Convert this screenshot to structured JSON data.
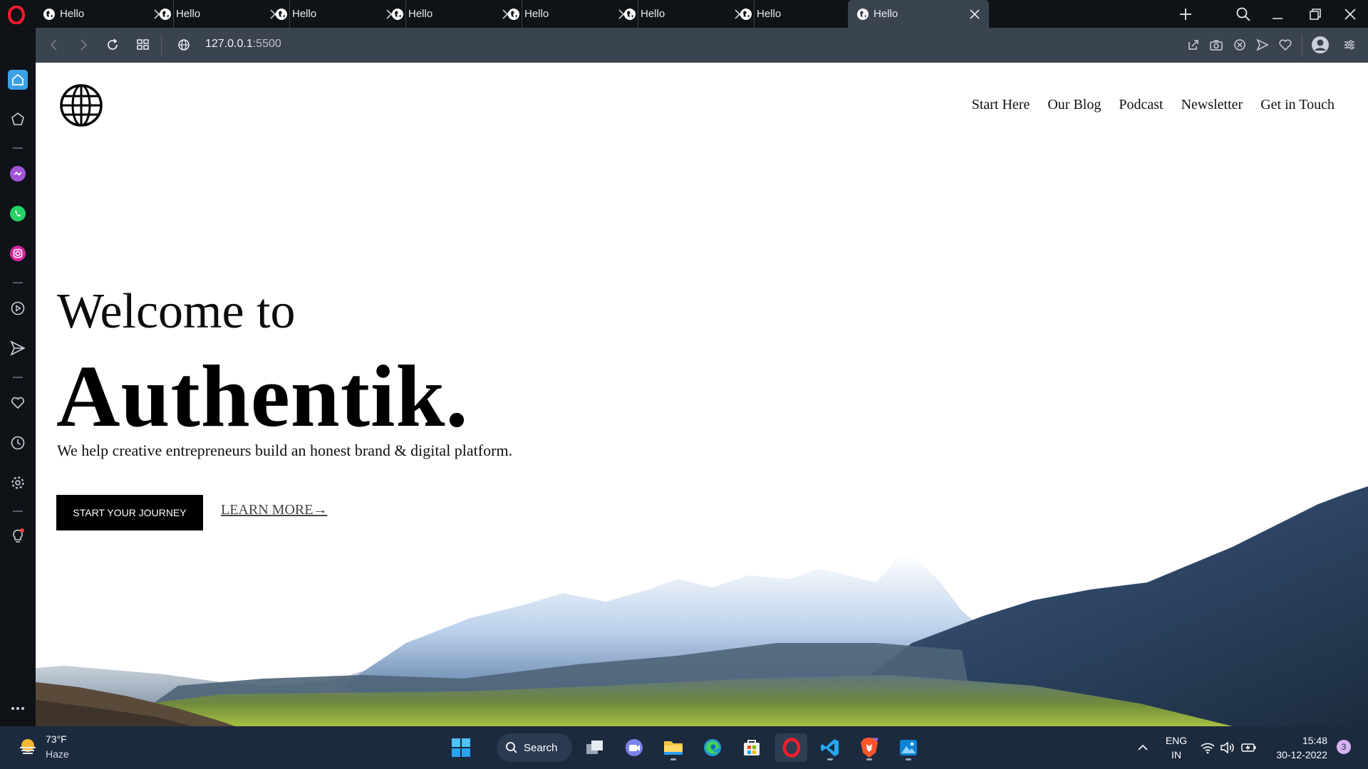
{
  "browser": {
    "tabs": [
      {
        "title": "Hello"
      },
      {
        "title": "Hello"
      },
      {
        "title": "Hello"
      },
      {
        "title": "Hello"
      },
      {
        "title": "Hello"
      },
      {
        "title": "Hello"
      },
      {
        "title": "Hello"
      },
      {
        "title": "Hello",
        "active": true
      }
    ],
    "url_host": "127.0.0.1",
    "url_port": ":5500",
    "sidebar_items": [
      "home-icon",
      "bookmarks-icon",
      "messenger-icon",
      "whatsapp-icon",
      "instagram-icon",
      "player-icon",
      "flow-icon",
      "pinboard-icon",
      "history-icon",
      "settings-icon",
      "tips-icon",
      "more-icon"
    ],
    "accent": "#3a4350"
  },
  "site": {
    "nav": [
      "Start Here",
      "Our Blog",
      "Podcast",
      "Newsletter",
      "Get in Touch"
    ],
    "welcome": "Welcome to",
    "brand": "Authentik.",
    "tagline": "We help creative entrepreneurs build an honest brand & digital platform.",
    "cta_label": "START YOUR JOURNEY",
    "learn_label": "LEARN MORE→"
  },
  "taskbar": {
    "temperature": "73°F",
    "condition": "Haze",
    "search_label": "Search",
    "lang_line1": "ENG",
    "lang_line2": "IN",
    "time": "15:48",
    "date": "30-12-2022",
    "notification_count": "3"
  }
}
